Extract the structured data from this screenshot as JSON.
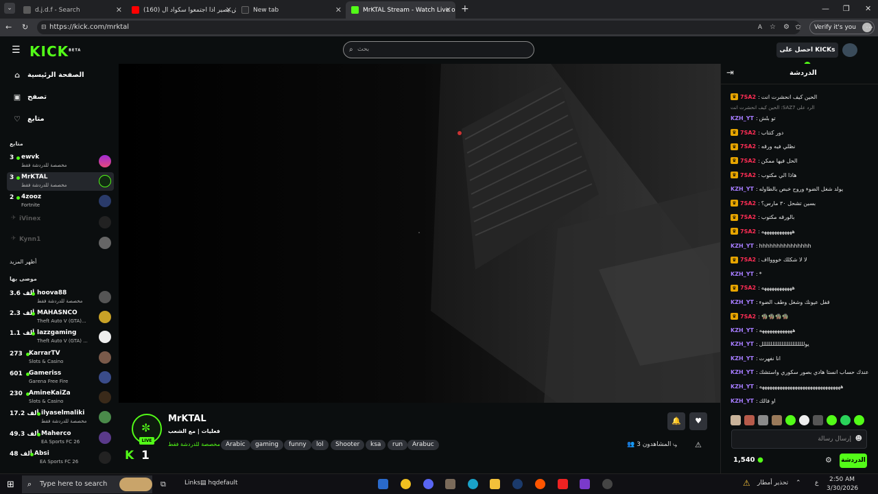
{
  "browser": {
    "tabs": [
      {
        "title": "d.j.d.f - Search"
      },
      {
        "title": "(160) وش يصير اذا اجتمعوا سكواد ال"
      },
      {
        "title": "New tab"
      },
      {
        "title": "MrKTAL Stream - Watch Live on Kick"
      }
    ],
    "url": "https://kick.com/mrktal",
    "verify_label": "Verify it's you",
    "new_tab_symbol": "+"
  },
  "header": {
    "logo": "KICK",
    "logo_beta": "BETA",
    "search_placeholder": "بحث",
    "get_kicks": "احصل على KICKs"
  },
  "sidebar": {
    "nav": [
      {
        "label": "الصفحة الرئيسية",
        "icon": "home-icon"
      },
      {
        "label": "تصفح",
        "icon": "browse-icon"
      },
      {
        "label": "متابع",
        "icon": "heart-icon"
      }
    ],
    "following_header": "متابع",
    "following": [
      {
        "count": "3",
        "name": "ewvk",
        "category": "مخصصة للدردشة فقط",
        "live": true
      },
      {
        "count": "3",
        "name": "MrKTAL",
        "category": "مخصصة للدردشة فقط",
        "live": true
      },
      {
        "count": "2",
        "name": "4zooz",
        "category": "Fortnite",
        "live": true
      },
      {
        "count": "",
        "name": "iVinex",
        "category": "",
        "live": false
      },
      {
        "count": "",
        "name": "Kynn1",
        "category": "",
        "live": false
      }
    ],
    "show_more": "أظهر المزيد",
    "recommended_header": "موصى بها",
    "recommended": [
      {
        "count": "3.6 ألف",
        "name": "hoova88",
        "category": "مخصصة للدردشة فقط"
      },
      {
        "count": "2.3 ألف",
        "name": "MAHASNCO",
        "category": "Theft Auto V (GTA)..."
      },
      {
        "count": "1.1 ألف",
        "name": "lazzgaming",
        "category": "Theft Auto V (GTA) ..."
      },
      {
        "count": "273",
        "name": "KarrarTV",
        "category": "Slots & Casino"
      },
      {
        "count": "601",
        "name": "Gameriss",
        "category": "Garena Free Fire"
      },
      {
        "count": "230",
        "name": "AmineKaiZa",
        "category": "Slots & Casino"
      },
      {
        "count": "17.2 ألف",
        "name": "ilyaselmaliki",
        "category": "مخصصة للدردشة فقط"
      },
      {
        "count": "49.3 ألف",
        "name": "Maherco",
        "category": "EA Sports FC 26"
      },
      {
        "count": "48 ألف",
        "name": "Absi",
        "category": "EA Sports FC 26"
      }
    ]
  },
  "stream": {
    "channel": "MrKTAL",
    "title": "فعليات | مع الشعب",
    "category": "مخصصة للدردشة فقط",
    "tags": [
      "Arabic",
      "gaming",
      "funny",
      "lol",
      "Shooter",
      "ksa",
      "run",
      "Arabuc"
    ],
    "live_label": "LIVE",
    "kicks_count": "1",
    "kicks_icon": "K",
    "viewers_label": "المشاهدون 3"
  },
  "chat": {
    "title": "الدردشة",
    "messages": [
      {
        "type": "msg",
        "user": "7SA2",
        "color": "red",
        "crown": true,
        "text": "الحين كيف انحشرت انت"
      },
      {
        "type": "reply",
        "text": "الحين كيف انحشرت انت :SAZالرد على 7"
      },
      {
        "type": "msg",
        "user": "KZH_YT",
        "color": "purple",
        "crown": false,
        "text": "تو بلش"
      },
      {
        "type": "msg",
        "user": "7SA2",
        "color": "red",
        "crown": true,
        "text": "دور كتتاب"
      },
      {
        "type": "msg",
        "user": "7SA2",
        "color": "red",
        "crown": true,
        "text": "نظلي فيه ورقه"
      },
      {
        "type": "msg",
        "user": "7SA2",
        "color": "red",
        "crown": true,
        "text": "الحل فيها ممكن"
      },
      {
        "type": "msg",
        "user": "7SA2",
        "color": "red",
        "crown": true,
        "text": "هاذا الي مكتوب"
      },
      {
        "type": "msg",
        "user": "KZH_YT",
        "color": "purple",
        "crown": false,
        "text": "يولد شغل الضوء وروح خبص بالطاوله"
      },
      {
        "type": "msg",
        "user": "7SA2",
        "color": "red",
        "crown": true,
        "text": "بسين تشحل ٣٠ مارس؟"
      },
      {
        "type": "msg",
        "user": "7SA2",
        "color": "red",
        "crown": true,
        "text": "بالورقه مكتوب"
      },
      {
        "type": "msg",
        "user": "7SA2",
        "color": "red",
        "crown": true,
        "text": "ههههههههههههه"
      },
      {
        "type": "msg",
        "user": "KZH_YT",
        "color": "purple",
        "crown": false,
        "text": "hhhhhhhhhhhhhhh"
      },
      {
        "type": "msg",
        "user": "7SA2",
        "color": "red",
        "crown": true,
        "text": "لا لا شكلك خوووااف"
      },
      {
        "type": "msg",
        "user": "KZH_YT",
        "color": "purple",
        "crown": false,
        "text": "*"
      },
      {
        "type": "msg",
        "user": "7SA2",
        "color": "red",
        "crown": true,
        "text": "ههههههههههههه"
      },
      {
        "type": "msg",
        "user": "KZH_YT",
        "color": "purple",
        "crown": false,
        "text": "قفل عيونك وشغل وطف الضوء"
      },
      {
        "type": "msg",
        "user": "7SA2",
        "color": "red",
        "crown": true,
        "text": "🧌🧌🧌🧌"
      },
      {
        "type": "msg",
        "user": "KZH_YT",
        "color": "purple",
        "crown": false,
        "text": "هههههههههههههه"
      },
      {
        "type": "msg",
        "user": "KZH_YT",
        "color": "purple",
        "crown": false,
        "text": "يولللللللللللللللللللللللل"
      },
      {
        "type": "msg",
        "user": "KZH_YT",
        "color": "purple",
        "crown": false,
        "text": "انا نفهرت"
      },
      {
        "type": "msg",
        "user": "KZH_YT",
        "color": "purple",
        "crown": false,
        "text": "عندك حساب انستا هادي بصور سكوري واستشك"
      },
      {
        "type": "msg",
        "user": "KZH_YT",
        "color": "purple",
        "crown": false,
        "text": "ههههههههههههههههههههههههههههههههه"
      },
      {
        "type": "msg",
        "user": "KZH_YT",
        "color": "purple",
        "crown": false,
        "text": "او فالك"
      }
    ],
    "input_placeholder": "إرسال رسالة",
    "kicks_points": "1,540",
    "chat_button": "الدردشة"
  },
  "taskbar": {
    "search_placeholder": "Type here to search",
    "links": "Links",
    "hqdefault": "hqdefault",
    "weather": "تحذير أمطار",
    "lang": "ع",
    "time": "2:50 AM",
    "date": "3/30/2026"
  },
  "colors": {
    "accent": "#53fc18",
    "red_user": "#ff2d55",
    "purple_user": "#a67cff",
    "crown": "#e7a500"
  }
}
